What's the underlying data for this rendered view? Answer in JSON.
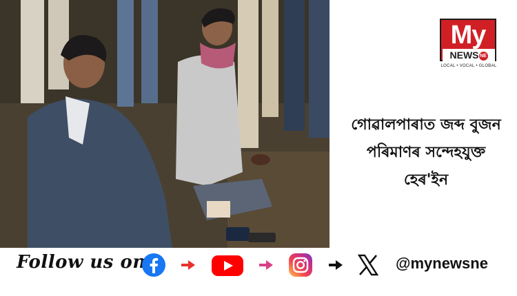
{
  "headline": {
    "lines": [
      "গোৱালপাৰাত জব্দ বুজন",
      "পৰিমাণৰ সন্দেহযুক্ত",
      "হেৰ'ইন"
    ]
  },
  "logo": {
    "my": "My",
    "news": "NEWS",
    "ne": "NE",
    "tagline": "LOCAL • VOCAL • GLOBAL",
    "color": "#d11f26"
  },
  "social": {
    "follow_text": "Follow us on",
    "platforms": [
      "facebook-icon",
      "youtube-icon",
      "instagram-icon",
      "x-icon"
    ],
    "arrow_colors": [
      "#e5322d",
      "#d93f86",
      "#111111"
    ],
    "handle": "@mynewsne"
  }
}
